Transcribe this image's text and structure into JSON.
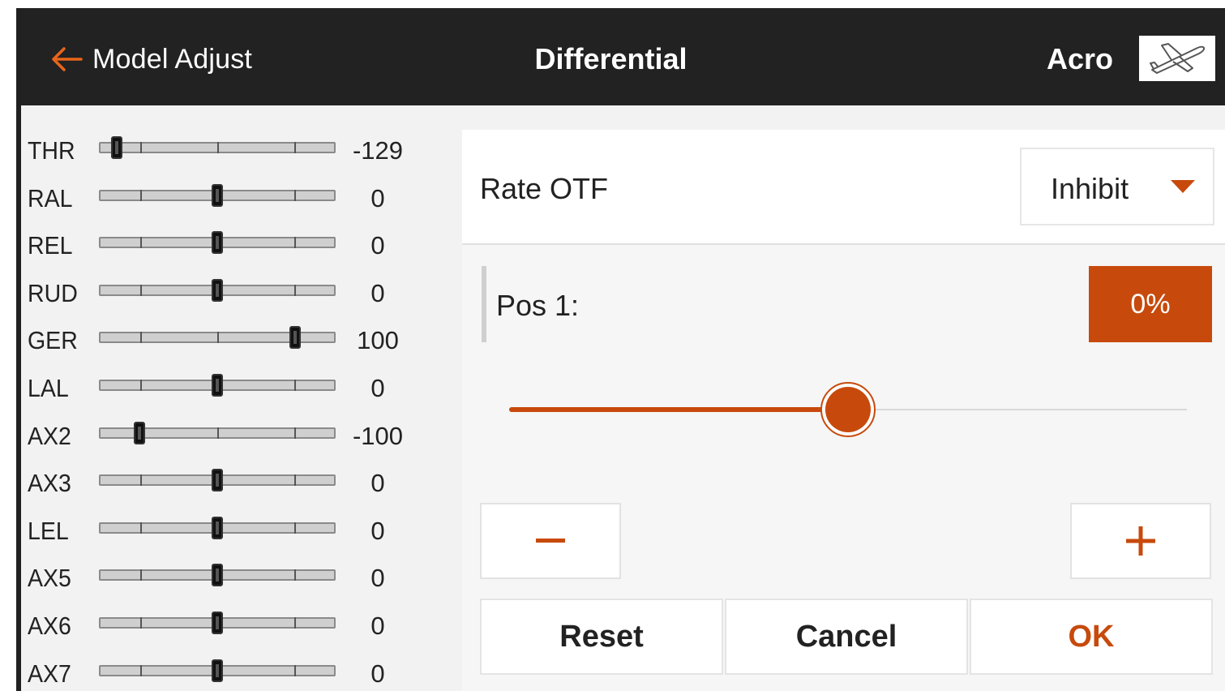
{
  "header": {
    "back_label": "Model Adjust",
    "title": "Differential",
    "model_name": "Acro",
    "icons": {
      "back": "arrow-left-icon",
      "model": "airplane-icon"
    }
  },
  "channels": [
    {
      "label": "THR",
      "value": "-129",
      "position": -1.29
    },
    {
      "label": "RAL",
      "value": "0",
      "position": 0
    },
    {
      "label": "REL",
      "value": "0",
      "position": 0
    },
    {
      "label": "RUD",
      "value": "0",
      "position": 0
    },
    {
      "label": "GER",
      "value": "100",
      "position": 1.0
    },
    {
      "label": "LAL",
      "value": "0",
      "position": 0
    },
    {
      "label": "AX2",
      "value": "-100",
      "position": -1.0
    },
    {
      "label": "AX3",
      "value": "0",
      "position": 0
    },
    {
      "label": "LEL",
      "value": "0",
      "position": 0
    },
    {
      "label": "AX5",
      "value": "0",
      "position": 0
    },
    {
      "label": "AX6",
      "value": "0",
      "position": 0
    },
    {
      "label": "AX7",
      "value": "0",
      "position": 0
    }
  ],
  "rate_otf": {
    "label": "Rate OTF",
    "selected": "Inhibit"
  },
  "position": {
    "label": "Pos 1:",
    "value_text": "0%",
    "slider_fraction": 0.5
  },
  "step_buttons": {
    "minus": "–",
    "plus": "+"
  },
  "actions": {
    "reset": "Reset",
    "cancel": "Cancel",
    "ok": "OK"
  },
  "colors": {
    "accent": "#c74a0c",
    "header_bg": "#222222",
    "content_bg": "#f2f2f2"
  }
}
